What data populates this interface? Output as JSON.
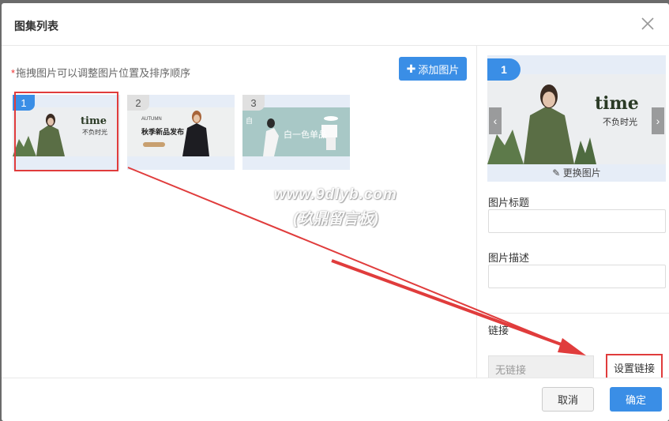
{
  "dialog": {
    "title": "图集列表",
    "close_icon": "close-icon"
  },
  "left": {
    "hint_required": "*",
    "hint": "拖拽图片可以调整图片位置及排序顺序",
    "add_button": "添加图片",
    "thumbnails": [
      {
        "num": "1",
        "caption": "time",
        "subcaption": "不负时光",
        "selected": true
      },
      {
        "num": "2",
        "caption": "秋季新品发布",
        "subcaption": "AUTUMN",
        "selected": false
      },
      {
        "num": "3",
        "caption": "白一色单品",
        "subcaption": "自",
        "selected": false
      }
    ]
  },
  "right": {
    "preview_num": "1",
    "preview_caption": "time",
    "preview_subcaption": "不负时光",
    "change_image": "更换图片",
    "title_label": "图片标题",
    "title_value": "",
    "desc_label": "图片描述",
    "desc_value": "",
    "link_label": "链接",
    "link_value": "无链接",
    "set_link": "设置链接"
  },
  "footer": {
    "cancel": "取消",
    "ok": "确定"
  },
  "watermark": {
    "line1": "www.9dlyb.com",
    "line2": "(玖鼎留言板)"
  },
  "colors": {
    "primary": "#3a8ee6",
    "annotation_red": "#e03c3c"
  }
}
